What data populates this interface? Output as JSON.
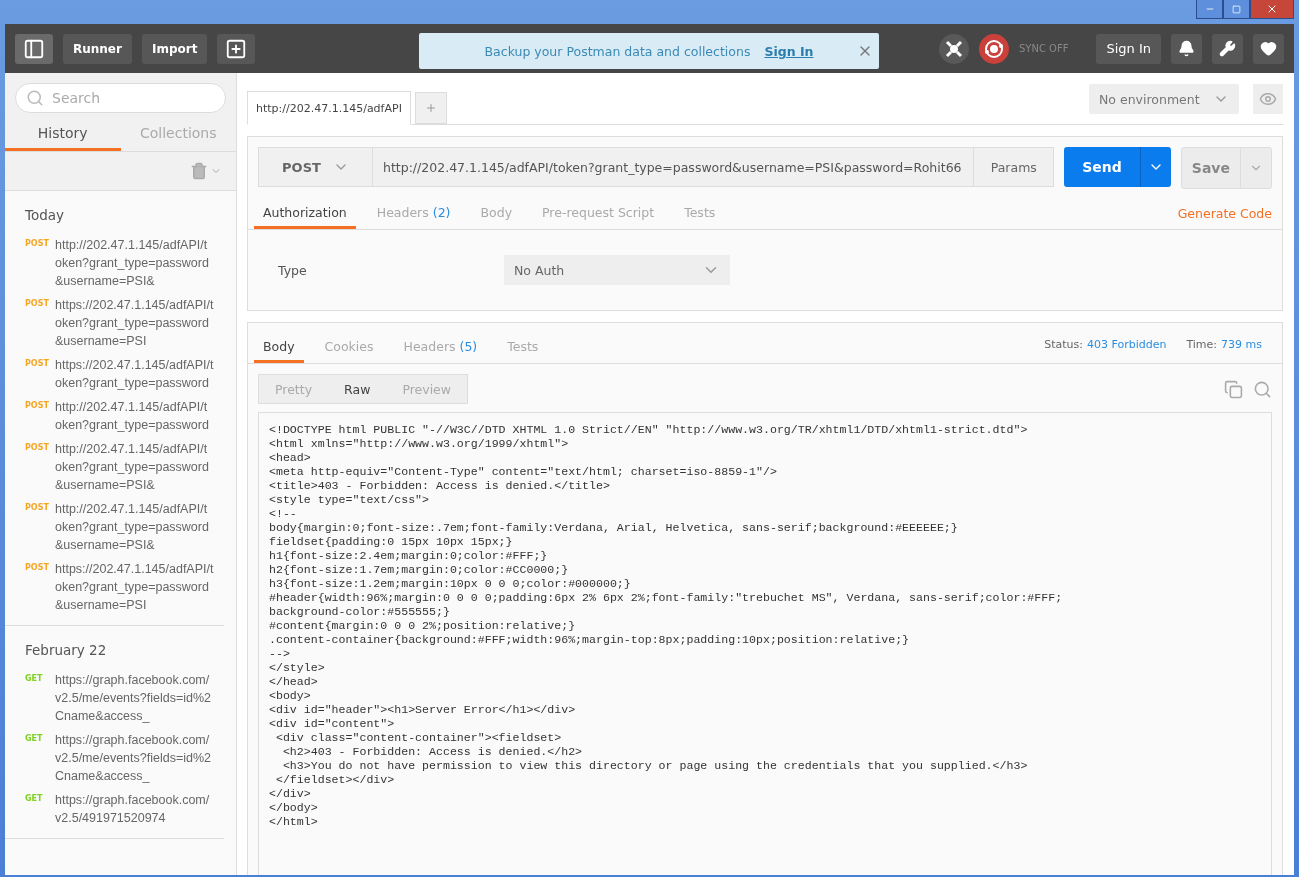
{
  "toolbar": {
    "buttons": [
      "Runner",
      "Import"
    ],
    "banner": {
      "text": "Backup your Postman data and collections",
      "link": "Sign In"
    },
    "sync": "SYNC OFF",
    "sign_in": "Sign In"
  },
  "sidebar": {
    "search": {
      "placeholder": "Search"
    },
    "tabs": [
      {
        "label": "History",
        "selected": true
      },
      {
        "label": "Collections",
        "selected": false
      }
    ],
    "groups": [
      {
        "title": "Today",
        "items": [
          {
            "method": "POST",
            "url": "http://202.47.1.145/adfAPI/token?grant_type=password&username=PSI&"
          },
          {
            "method": "POST",
            "url": "https://202.47.1.145/adfAPI/token?grant_type=password&username=PSI"
          },
          {
            "method": "POST",
            "url": "https://202.47.1.145/adfAPI/token?grant_type=password"
          },
          {
            "method": "POST",
            "url": "http://202.47.1.145/adfAPI/token?grant_type=password"
          },
          {
            "method": "POST",
            "url": "http://202.47.1.145/adfAPI/token?grant_type=password&username=PSI&"
          },
          {
            "method": "POST",
            "url": "http://202.47.1.145/adfAPI/token?grant_type=password&username=PSI&"
          },
          {
            "method": "POST",
            "url": "https://202.47.1.145/adfAPI/token?grant_type=password&username=PSI"
          }
        ]
      },
      {
        "title": "February 22",
        "items": [
          {
            "method": "GET",
            "url": "https://graph.facebook.com/v2.5/me/events?fields=id%2Cname&access_"
          },
          {
            "method": "GET",
            "url": "https://graph.facebook.com/v2.5/me/events?fields=id%2Cname&access_"
          },
          {
            "method": "GET",
            "url": "https://graph.facebook.com/v2.5/491971520974"
          }
        ]
      }
    ]
  },
  "request_tabs": [
    {
      "label": "http://202.47.1.145/adfAPI",
      "selected": true
    }
  ],
  "environment": "No environment",
  "request": {
    "method": "POST",
    "url": "http://202.47.1.145/adfAPI/token?grant_type=password&username=PSI&password=Rohit66",
    "params": "Params",
    "send": "Send",
    "save": "Save",
    "tabs": [
      {
        "label": "Authorization",
        "selected": true
      },
      {
        "label": "Headers",
        "count": "(2)",
        "selected": false
      },
      {
        "label": "Body",
        "selected": false
      },
      {
        "label": "Pre-request Script",
        "selected": false
      },
      {
        "label": "Tests",
        "selected": false
      }
    ],
    "generate_code": "Generate Code",
    "auth": {
      "label": "Type",
      "value": "No Auth"
    }
  },
  "response": {
    "tabs": [
      {
        "label": "Body",
        "selected": true
      },
      {
        "label": "Cookies",
        "selected": false
      },
      {
        "label": "Headers",
        "count": "(5)",
        "selected": false
      },
      {
        "label": "Tests",
        "selected": false
      }
    ],
    "status_label": "Status:",
    "status": "403 Forbidden",
    "time_label": "Time:",
    "time": "739 ms",
    "view_modes": [
      {
        "label": "Pretty",
        "selected": false
      },
      {
        "label": "Raw",
        "selected": true
      },
      {
        "label": "Preview",
        "selected": false
      }
    ],
    "body_lines": [
      "<!DOCTYPE html PUBLIC \"-//W3C//DTD XHTML 1.0 Strict//EN\" \"http://www.w3.org/TR/xhtml1/DTD/xhtml1-strict.dtd\">",
      "<html xmlns=\"http://www.w3.org/1999/xhtml\">",
      "<head>",
      "<meta http-equiv=\"Content-Type\" content=\"text/html; charset=iso-8859-1\"/>",
      "<title>403 - Forbidden: Access is denied.</title>",
      "<style type=\"text/css\">",
      "<!--",
      "body{margin:0;font-size:.7em;font-family:Verdana, Arial, Helvetica, sans-serif;background:#EEEEEE;}",
      "fieldset{padding:0 15px 10px 15px;}",
      "h1{font-size:2.4em;margin:0;color:#FFF;}",
      "h2{font-size:1.7em;margin:0;color:#CC0000;}",
      "h3{font-size:1.2em;margin:10px 0 0 0;color:#000000;}",
      "#header{width:96%;margin:0 0 0 0;padding:6px 2% 6px 2%;font-family:\"trebuchet MS\", Verdana, sans-serif;color:#FFF;",
      "background-color:#555555;}",
      "#content{margin:0 0 0 2%;position:relative;}",
      ".content-container{background:#FFF;width:96%;margin-top:8px;padding:10px;position:relative;}",
      "-->",
      "</style>",
      "</head>",
      "<body>",
      "<div id=\"header\"><h1>Server Error</h1></div>",
      "<div id=\"content\">",
      " <div class=\"content-container\"><fieldset>",
      "  <h2>403 - Forbidden: Access is denied.</h2>",
      "  <h3>You do not have permission to view this directory or page using the credentials that you supplied.</h3>",
      " </fieldset></div>",
      "</div>",
      "</body>",
      "</html>"
    ]
  }
}
